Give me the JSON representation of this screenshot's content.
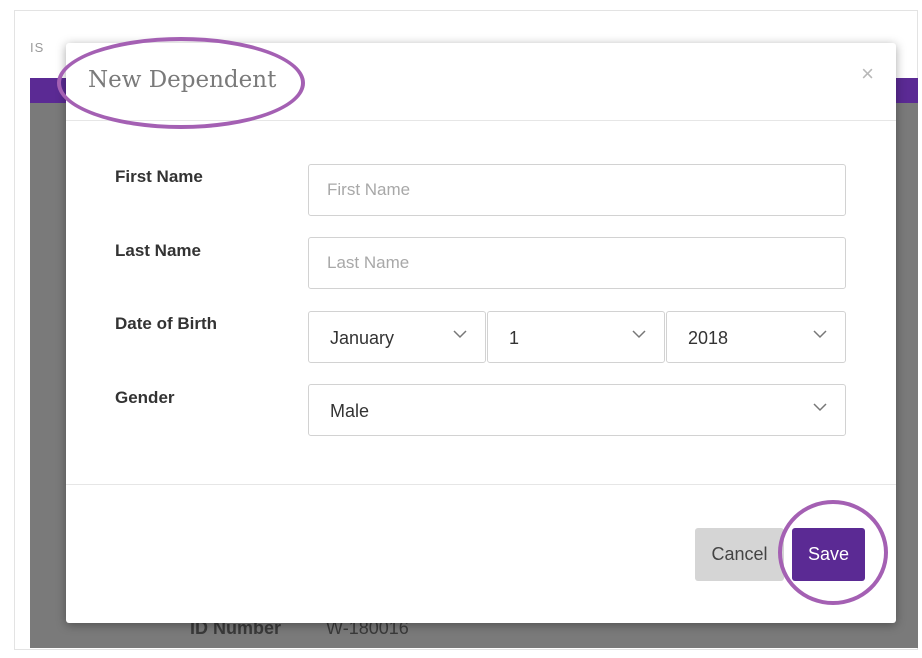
{
  "background": {
    "tab_fragment": "IS",
    "id_label": "ID Number",
    "id_value": "W-180016"
  },
  "modal": {
    "title": "New Dependent",
    "close_glyph": "×",
    "fields": {
      "first_name": {
        "label": "First Name",
        "placeholder": "First Name",
        "value": ""
      },
      "last_name": {
        "label": "Last Name",
        "placeholder": "Last Name",
        "value": ""
      },
      "dob": {
        "label": "Date of Birth",
        "month": "January",
        "day": "1",
        "year": "2018"
      },
      "gender": {
        "label": "Gender",
        "value": "Male"
      }
    },
    "buttons": {
      "cancel": "Cancel",
      "save": "Save"
    }
  },
  "icons": {
    "close": "close-icon",
    "dropdown": "chevron-down-icon"
  },
  "colors": {
    "accent": "#5b2a94",
    "highlight": "#a460b3",
    "overlay": "#7a7a7a"
  }
}
